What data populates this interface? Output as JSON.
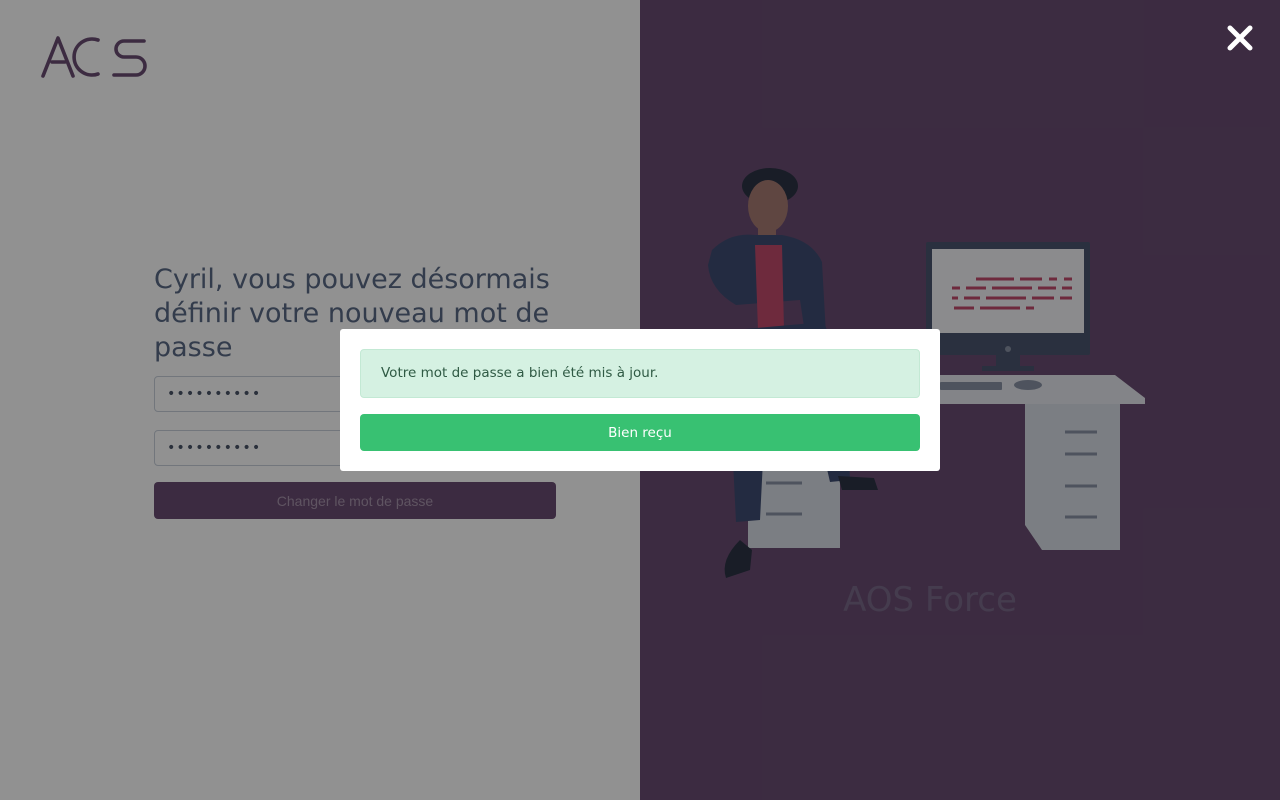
{
  "brand": {
    "logo_text": "AOS",
    "name": "AOS Force"
  },
  "form": {
    "heading": "Cyril, vous pouvez désormais définir votre nouveau mot de passe",
    "password_value": "••••••••••",
    "confirm_value": "••••••••••",
    "submit_label": "Changer le mot de passe"
  },
  "modal": {
    "message": "Votre mot de passe a bien été mis à jour.",
    "button_label": "Bien reçu"
  },
  "icons": {
    "close": "close-icon"
  },
  "colors": {
    "accent_purple": "#6a4d72",
    "success_green": "#38c172",
    "alert_bg": "#d5f1e2"
  }
}
